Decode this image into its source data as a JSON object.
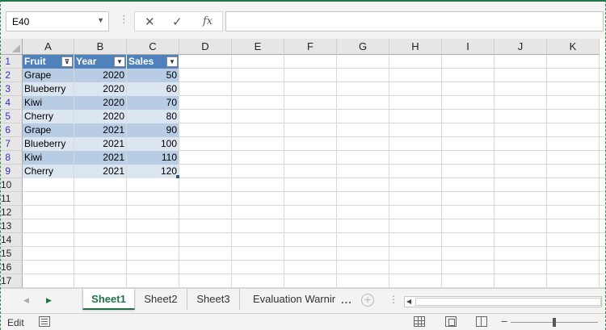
{
  "formula_bar": {
    "name_box": "E40",
    "separator": "⋮",
    "cancel_icon": "✕",
    "enter_icon": "✓",
    "fx_label": "fx",
    "formula": ""
  },
  "columns": [
    "A",
    "B",
    "C",
    "D",
    "E",
    "F",
    "G",
    "H",
    "I",
    "J",
    "K"
  ],
  "rows": [
    "1",
    "2",
    "3",
    "4",
    "5",
    "6",
    "7",
    "8",
    "9",
    "10",
    "11",
    "12",
    "13",
    "14",
    "15",
    "16",
    "17"
  ],
  "table": {
    "headers": [
      "Fruit",
      "Year",
      "Sales"
    ],
    "data": [
      [
        "Grape",
        "2020",
        "50"
      ],
      [
        "Blueberry",
        "2020",
        "60"
      ],
      [
        "Kiwi",
        "2020",
        "70"
      ],
      [
        "Cherry",
        "2020",
        "80"
      ],
      [
        "Grape",
        "2021",
        "90"
      ],
      [
        "Blueberry",
        "2021",
        "100"
      ],
      [
        "Kiwi",
        "2021",
        "110"
      ],
      [
        "Cherry",
        "2021",
        "120"
      ]
    ],
    "header_color": "#4f81bd",
    "band_color_1": "#b8cce4",
    "band_color_2": "#dce6f1"
  },
  "sheets": {
    "tabs": [
      "Sheet1",
      "Sheet2",
      "Sheet3",
      "Evaluation Warnir"
    ],
    "active": "Sheet1",
    "more": "...",
    "add": "+"
  },
  "status": {
    "mode": "Edit",
    "zoom_minus": "−"
  },
  "colors": {
    "accent": "#217346"
  }
}
